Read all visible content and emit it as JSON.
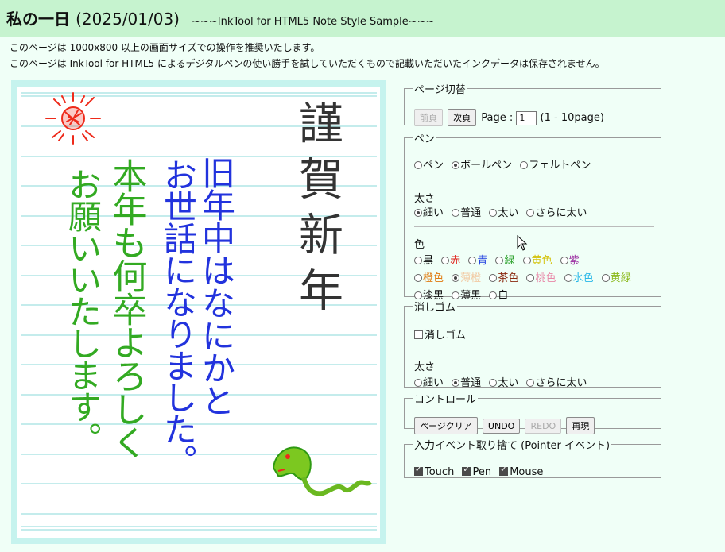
{
  "header": {
    "title": "私の一日",
    "date": "(2025/01/03)",
    "subtitle": "~~~InkTool for HTML5 Note Style Sample~~~"
  },
  "notices": [
    "このページは 1000x800 以上の画面サイズでの操作を推奨いたします。",
    "このページは InkTool for HTML5 によるデジタルペンの使い勝手を試していただくもので記載いただいたインクデータは保存されません。"
  ],
  "page_switch": {
    "legend": "ページ切替",
    "prev_label": "前頁",
    "next_label": "次頁",
    "page_label": "Page :",
    "page_value": "1",
    "range_label": "(1 - 10page)"
  },
  "pen": {
    "legend": "ペン",
    "types": [
      "ペン",
      "ボールペン",
      "フェルトペン"
    ],
    "selected_type": "ボールペン",
    "thickness_label": "太さ",
    "thickness": [
      "細い",
      "普通",
      "太い",
      "さらに太い"
    ],
    "selected_thickness": "細い",
    "color_label": "色",
    "colors": [
      {
        "name": "黒",
        "hex": "#000000"
      },
      {
        "name": "赤",
        "hex": "#e0201a"
      },
      {
        "name": "青",
        "hex": "#1f3fe0"
      },
      {
        "name": "緑",
        "hex": "#2aa02a"
      },
      {
        "name": "黄色",
        "hex": "#d4c20a"
      },
      {
        "name": "紫",
        "hex": "#9a2aa0"
      },
      {
        "name": "橙色",
        "hex": "#e07a10"
      },
      {
        "name": "薄橙",
        "hex": "#f2c8a0"
      },
      {
        "name": "茶色",
        "hex": "#8a2a10"
      },
      {
        "name": "桃色",
        "hex": "#e888a8"
      },
      {
        "name": "水色",
        "hex": "#2ab8e8"
      },
      {
        "name": "黄緑",
        "hex": "#8ab81a"
      },
      {
        "name": "漆黒",
        "hex": "#000000"
      },
      {
        "name": "薄黒",
        "hex": "#444444"
      },
      {
        "name": "白",
        "hex": "#000000"
      }
    ],
    "selected_color": "薄橙"
  },
  "eraser": {
    "legend": "消しゴム",
    "checkbox_label": "消しゴム",
    "checked": false,
    "thickness_label": "太さ",
    "thickness": [
      "細い",
      "普通",
      "太い",
      "さらに太い"
    ],
    "selected_thickness": "普通"
  },
  "control": {
    "legend": "コントロール",
    "clear_label": "ページクリア",
    "undo_label": "UNDO",
    "redo_label": "REDO",
    "redraw_label": "再現"
  },
  "input_events": {
    "legend": "入力イベント取り捨て (Pointer イベント)",
    "items": [
      {
        "label": "Touch",
        "checked": true
      },
      {
        "label": "Pen",
        "checked": true
      },
      {
        "label": "Mouse",
        "checked": true
      }
    ]
  },
  "handwriting": {
    "col1": "謹賀新年",
    "col2": "旧年中はなにかと",
    "col3": "お世話になりました。",
    "col4": "本年も何卒よろしく",
    "col5": "お願いいたします。"
  },
  "colors": {
    "header_bg": "#c6f3cf",
    "page_bg": "#f0fff7",
    "canvas_border": "#c6f3ee",
    "rule_line": "#8ad8d8",
    "ink_black": "#333333",
    "ink_blue": "#2233dd",
    "ink_green": "#33aa22",
    "ink_red": "#ee2a1a"
  }
}
